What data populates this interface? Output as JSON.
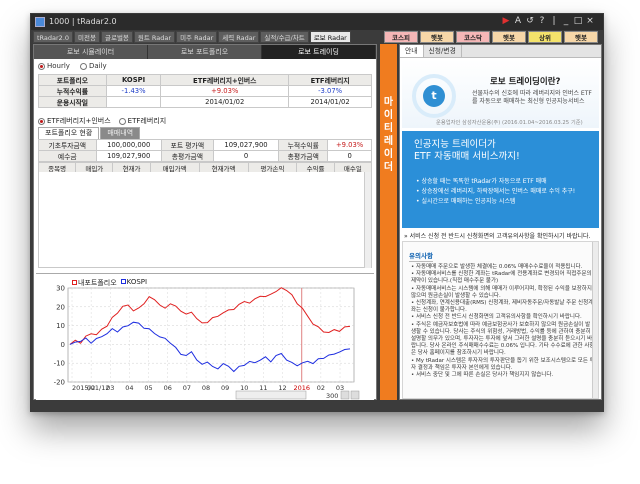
{
  "window": {
    "title": "1000 | tRadar2.0",
    "controls": [
      "▶",
      "A",
      "↺",
      "?",
      "|",
      "_",
      "□",
      "×"
    ]
  },
  "menu_tabs": [
    {
      "label": "tRadar2.0",
      "active": false
    },
    {
      "label": "미전봉",
      "active": false
    },
    {
      "label": "글로벌봉",
      "active": false
    },
    {
      "label": "원트 Radar",
      "active": false
    },
    {
      "label": "미주 Radar",
      "active": false
    },
    {
      "label": "세력 Radar",
      "active": false
    },
    {
      "label": "실적/수급/차트",
      "active": false
    },
    {
      "label": "로보 Radar",
      "active": true
    }
  ],
  "quick_tabs": [
    {
      "label": "코스피",
      "color": "#f5b7b7"
    },
    {
      "label": "햇봇",
      "color": "#f7d7a8"
    },
    {
      "label": "코스닥",
      "color": "#f5b7b7"
    },
    {
      "label": "햇봇",
      "color": "#f7d7a8"
    },
    {
      "label": "상위",
      "color": "#f4e36b"
    },
    {
      "label": "햇봇",
      "color": "#f7d7a8"
    }
  ],
  "sub_tabs": [
    {
      "label": "로보 시뮬레이터",
      "active": false
    },
    {
      "label": "로보 포트폴리오",
      "active": false
    },
    {
      "label": "로보 트레이딩",
      "active": true
    }
  ],
  "period_radios": [
    {
      "label": "Hourly",
      "checked": true
    },
    {
      "label": "Daily",
      "checked": false
    }
  ],
  "summary_table": {
    "headers": [
      "포트폴리오",
      "KOSPI",
      "ETF레버리지+인버스",
      "ETF레버리지"
    ],
    "rows": [
      {
        "label": "누적수익률",
        "kospi": "-1.43%",
        "etf_lev_inv": "+9.03%",
        "etf_lev": "-3.07%"
      },
      {
        "label": "운용시작일",
        "kospi": "",
        "etf_lev_inv": "2014/01/02",
        "etf_lev": "2014/01/02"
      }
    ]
  },
  "strategy_radios": [
    {
      "label": "ETF레버리지+인버스",
      "checked": true
    },
    {
      "label": "ETF레버리지",
      "checked": false
    }
  ],
  "portfolio_tabs": [
    {
      "label": "포트폴리오 현황",
      "active": true
    },
    {
      "label": "매매내역",
      "active": false
    }
  ],
  "status_table": {
    "row1": {
      "l1": "기초투자금액",
      "v1": "100,000,000",
      "l2": "포트 평가액",
      "v2": "109,027,900",
      "l3": "누적수익률",
      "v3": "+9.03%"
    },
    "row2": {
      "l1": "예수금",
      "v1": "109,027,900",
      "l2": "총평가금액",
      "v2": "0",
      "l3": "총평가금액",
      "v3": "0"
    }
  },
  "holdings_headers": [
    "종목명",
    "매입가",
    "현재가",
    "매입가액",
    "현재가액",
    "평가손익",
    "수익률",
    "매수일"
  ],
  "chart_data": {
    "type": "line",
    "legend": [
      "내포트폴리오",
      "KOSPI"
    ],
    "x_tick_labels": [
      "2015/01/12",
      "02",
      "03",
      "04",
      "05",
      "06",
      "07",
      "08",
      "09",
      "10",
      "11",
      "12",
      "2016",
      "02",
      "03"
    ],
    "ylim": [
      -20,
      30
    ],
    "y_ticks": [
      30,
      20,
      10,
      0,
      -10,
      -20
    ],
    "grid": true,
    "series": [
      {
        "name": "내포트폴리오",
        "color": "#e02020",
        "values": [
          0,
          2,
          1,
          4,
          6,
          5,
          8,
          10,
          14,
          17,
          20,
          21,
          18,
          19,
          22,
          25,
          24,
          21,
          19,
          22,
          20,
          18,
          16,
          17,
          14,
          11,
          12,
          14,
          15,
          17,
          18,
          19,
          21,
          23,
          22,
          24,
          26,
          25,
          27,
          28,
          30,
          29,
          26,
          22,
          19,
          15,
          11,
          9,
          7,
          6,
          8,
          7,
          9,
          10
        ]
      },
      {
        "name": "KOSPI",
        "color": "#1e2ee0",
        "values": [
          0,
          1,
          2,
          3,
          1,
          3,
          4,
          6,
          8,
          7,
          9,
          10,
          12,
          11,
          9,
          8,
          6,
          4,
          3,
          1,
          -2,
          -5,
          -6,
          -4,
          -8,
          -11,
          -9,
          -12,
          -13,
          -10,
          -12,
          -14,
          -12,
          -11,
          -9,
          -10,
          -8,
          -7,
          -9,
          -6,
          -5,
          -8,
          -10,
          -11,
          -10,
          -9,
          -10,
          -8,
          -7,
          -6,
          -5,
          -4,
          -3,
          -2
        ]
      }
    ]
  },
  "chart_footer": {
    "zoom_value": "300"
  },
  "banner": {
    "text": "마이티레이더"
  },
  "right_tabs": [
    {
      "label": "안내",
      "active": true
    },
    {
      "label": "신청/변경",
      "active": false
    }
  ],
  "hero": {
    "icon_letter": "t",
    "title": "로보 트레이딩이란?",
    "desc": "선물자수의 신호에 따라 레버리지와 인버스 ETF를 자동으로 매매하는 최신형 인공지능서비스",
    "footer": "운용업자인 삼성자산운용(주) (2016.01.04~2016.03.25 기준)"
  },
  "promo": {
    "headline_1": "인공지능 트레이더가",
    "headline_2": "ETF 자동매매 서비스까지!",
    "bullets": [
      "상승할 때는 똑똑한 tRadar가 자동으로 ETF 매매",
      "상승장에선 레버리지, 하락장에서는 인버스 매매로 수익 추구!",
      "실시간으로 매매하는 인공지능 시스템"
    ]
  },
  "notice_line": "서비스 신청 전 반드시 신청화면의 고객유의사항을 확인하시기 바랍니다.",
  "caution": {
    "title": "유의사항",
    "items": [
      "자동매매 주문으로 발생한 체결에는 0.06% 매매수수료율이 적용됩니다.",
      "자동매매서비스를 신청한 계좌는 tRadar에 전용계좌로 변경되어 직접주문의 제약이 있습니다.(직접 매수주문 불가)",
      "자동매매서비스는 시스템에 의해 매매가 이루어지며, 확정된 수익을 보장하지 않으며 원금손실이 발생할 수 있습니다.",
      "신청계좌, 연계신용대출(RMS) 신청계좌, 제비자동주문/자동발날 주문 신청계좌는 신청이 불가합니다.",
      "서비스 신청 전 반드시 신청화면의 고객유의사항을 확인하시기 바랍니다.",
      "주식은 예금자보호법에 따라 예금보험공사가 보호하지 않으며 원금손실이 발생할 수 있습니다. 당사는 주식의 위험성, 거래방법, 수익률 등에 관하여 충분히 설명할 의무가 있으며, 투자자는 투자에 앞서 그러한 설명을 충분히 듣으시기 바랍니다. 당사 온라인 주식매매수수료는 0.06% 입니다. 기타 수수료에 관한 사항은 당사 홈페이지를 참조하시기 바랍니다.",
      "My tRadar 시스템은 투자자의 투자판단을 돕기 위한 보조시스템으로 모든 투자 결정과 책임은 투자자 본인에게 있습니다.",
      "서비스 중단 및 그에 따른 손실은 당사가 책임지지 않습니다."
    ]
  }
}
